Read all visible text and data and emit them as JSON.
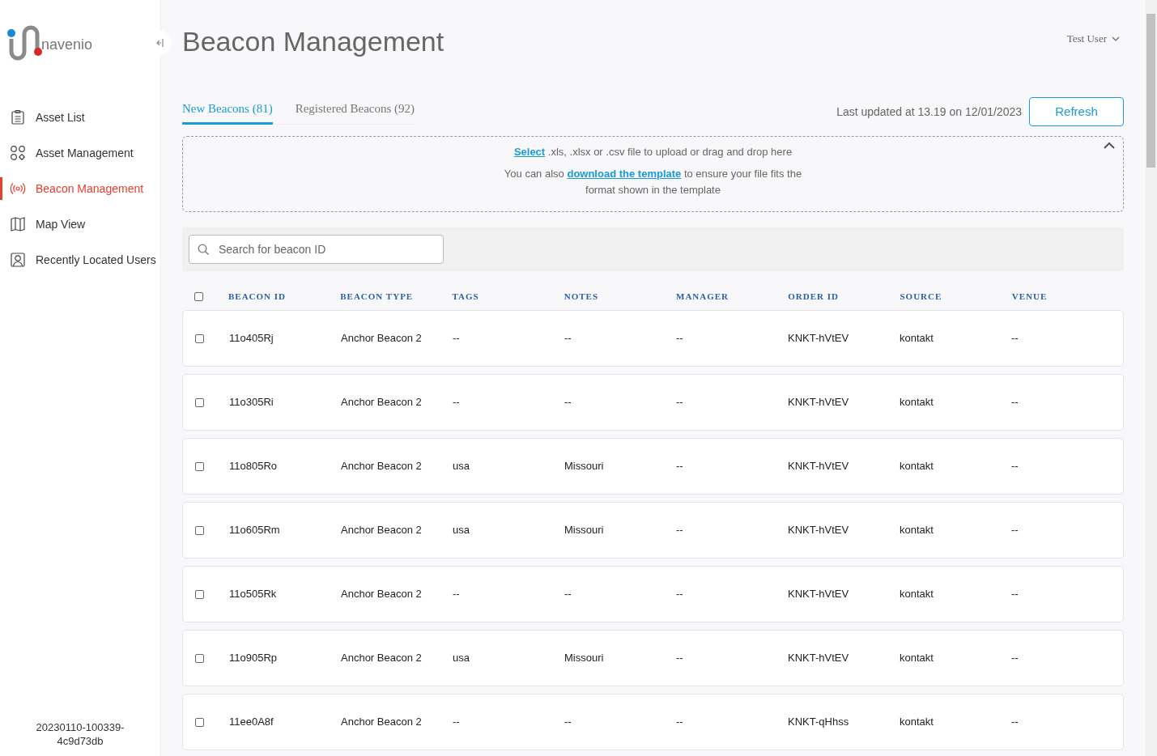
{
  "sidebar": {
    "logo_text": "navenio",
    "items": [
      {
        "label": "Asset List",
        "kind": "clipboard",
        "selected": false
      },
      {
        "label": "Asset Management",
        "kind": "shapes",
        "selected": false
      },
      {
        "label": "Beacon Management",
        "kind": "beacon",
        "selected": true
      },
      {
        "label": "Map View",
        "kind": "map",
        "selected": false
      },
      {
        "label": "Recently Located Users",
        "kind": "user",
        "selected": false
      }
    ],
    "version": "20230110-100339-4c9d73db"
  },
  "header": {
    "title": "Beacon Management",
    "user": "Test User"
  },
  "tabs": [
    {
      "label": "New Beacons (81)",
      "selected": true
    },
    {
      "label": "Registered Beacons (92)",
      "selected": false
    }
  ],
  "last_updated": "Last updated at 13.19 on 12/01/2023",
  "refresh_button": "Refresh",
  "upload": {
    "line_1": {
      "link": "Select",
      "after": " .xls, .xlsx or .csv file to upload or drag and drop here"
    },
    "line_2": {
      "before": "You can also ",
      "link": "download the template",
      "after": " to ensure your file fits the format shown in the template"
    },
    "expanded": true
  },
  "search": {
    "placeholder": "Search for beacon ID"
  },
  "table": {
    "select_all_checked": false,
    "columns": [
      "BEACON ID",
      "BEACON TYPE",
      "TAGS",
      "NOTES",
      "MANAGER",
      "ORDER ID",
      "SOURCE",
      "VENUE"
    ],
    "rows": [
      {
        "checked": false,
        "cells": [
          "11o405Rj",
          "Anchor Beacon 2",
          "--",
          "--",
          "--",
          "KNKT-hVtEV",
          "kontakt",
          "--"
        ]
      },
      {
        "checked": false,
        "cells": [
          "11o305Ri",
          "Anchor Beacon 2",
          "--",
          "--",
          "--",
          "KNKT-hVtEV",
          "kontakt",
          "--"
        ]
      },
      {
        "checked": false,
        "cells": [
          "11o805Ro",
          "Anchor Beacon 2",
          "usa",
          "Missouri",
          "--",
          "KNKT-hVtEV",
          "kontakt",
          "--"
        ]
      },
      {
        "checked": false,
        "cells": [
          "11o605Rm",
          "Anchor Beacon 2",
          "usa",
          "Missouri",
          "--",
          "KNKT-hVtEV",
          "kontakt",
          "--"
        ]
      },
      {
        "checked": false,
        "cells": [
          "11o505Rk",
          "Anchor Beacon 2",
          "--",
          "--",
          "--",
          "KNKT-hVtEV",
          "kontakt",
          "--"
        ]
      },
      {
        "checked": false,
        "cells": [
          "11o905Rp",
          "Anchor Beacon 2",
          "usa",
          "Missouri",
          "--",
          "KNKT-hVtEV",
          "kontakt",
          "--"
        ]
      },
      {
        "checked": false,
        "cells": [
          "11ee0A8f",
          "Anchor Beacon 2",
          "--",
          "--",
          "--",
          "KNKT-qHhss",
          "kontakt",
          "--"
        ]
      }
    ]
  }
}
